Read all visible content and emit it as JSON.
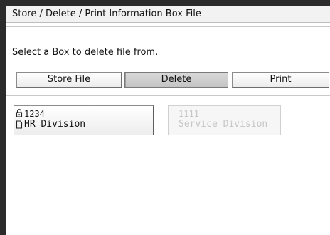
{
  "window": {
    "title": "Store / Delete / Print Information Box File"
  },
  "instruction": "Select a Box to delete file from.",
  "tabs": [
    {
      "label": "Store File",
      "active": false
    },
    {
      "label": "Delete",
      "active": true
    },
    {
      "label": "Print",
      "active": false
    }
  ],
  "boxes": [
    {
      "number": "1234",
      "name": "HR Division",
      "enabled": true,
      "icons": [
        "lock-icon",
        "document-icon"
      ]
    },
    {
      "number": "1111",
      "name": "Service Division",
      "enabled": false
    }
  ],
  "colors": {
    "active_tab": "#c8c8c8",
    "disabled_text": "#c6c6c6"
  }
}
